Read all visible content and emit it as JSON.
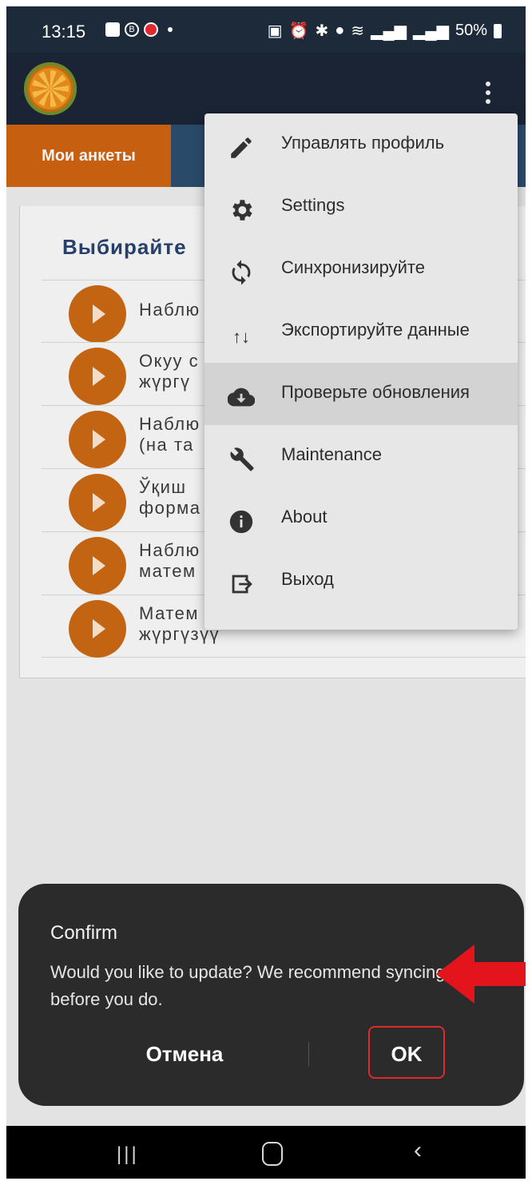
{
  "status_bar": {
    "time": "13:15",
    "battery": "50%",
    "left_icons": [
      "gallery-icon",
      "b-icon",
      "db-icon"
    ],
    "right_icons": [
      "lock-icon",
      "alarm-icon",
      "bluetooth-icon",
      "location-icon",
      "wifi-icon",
      "signal-icon",
      "signal-icon"
    ]
  },
  "tabs": {
    "active": "Мои анкеты"
  },
  "content": {
    "title": "Выбирайте",
    "items": [
      {
        "line1": "Наблю",
        "line2": ""
      },
      {
        "line1": "Окуу с",
        "line2": "жүргү"
      },
      {
        "line1": "Наблю",
        "line2": "(на та"
      },
      {
        "line1": "Ўқиш",
        "line2": "форма"
      },
      {
        "line1": "Наблю",
        "line2": "матем"
      },
      {
        "line1": "Матем",
        "line2": "жүргүзүү"
      }
    ]
  },
  "menu": {
    "items": [
      {
        "label": "Управлять профиль",
        "icon": "pencil-icon"
      },
      {
        "label": "Settings",
        "icon": "gear-icon"
      },
      {
        "label": "Синхронизируйте",
        "icon": "sync-icon"
      },
      {
        "label": "Экспортируйте данные",
        "icon": "sort-icon"
      },
      {
        "label": "Проверьте обновления",
        "icon": "cloud-download-icon"
      },
      {
        "label": "Maintenance",
        "icon": "wrench-icon"
      },
      {
        "label": "About",
        "icon": "info-icon"
      },
      {
        "label": "Выход",
        "icon": "logout-icon"
      }
    ]
  },
  "dialog": {
    "title": "Confirm",
    "message": "Would you like to update? We recommend syncing data before you do.",
    "cancel_label": "Отмена",
    "ok_label": "OK"
  },
  "colors": {
    "app_bar": "#1b2435",
    "tab_active": "#c75f10",
    "title": "#263f6b",
    "play_button": "#c36412",
    "highlight": "#e02a2a"
  }
}
